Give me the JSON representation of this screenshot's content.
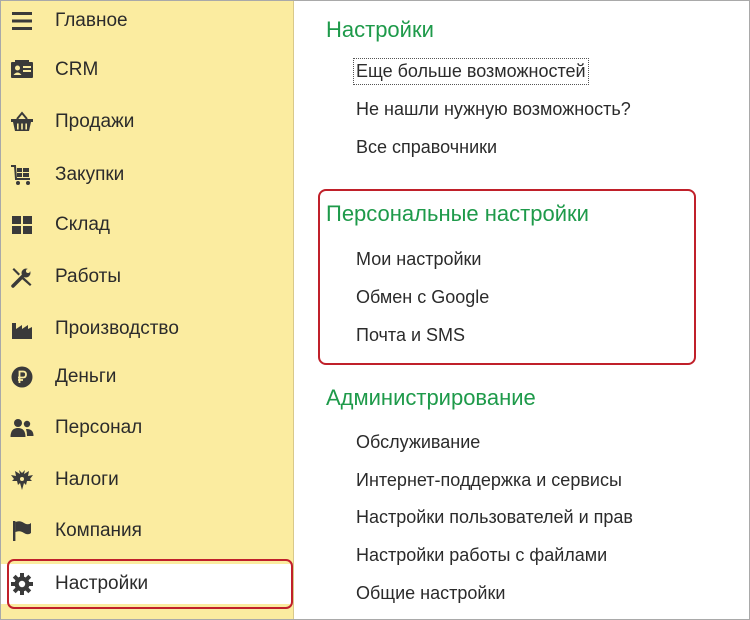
{
  "sidebar": {
    "items": [
      {
        "label": "Главное",
        "icon": "menu-lines-icon"
      },
      {
        "label": "CRM",
        "icon": "contact-card-icon"
      },
      {
        "label": "Продажи",
        "icon": "shopping-basket-icon"
      },
      {
        "label": "Закупки",
        "icon": "shopping-cart-icon"
      },
      {
        "label": "Склад",
        "icon": "warehouse-boxes-icon"
      },
      {
        "label": "Работы",
        "icon": "tools-icon"
      },
      {
        "label": "Производство",
        "icon": "factory-icon"
      },
      {
        "label": "Деньги",
        "icon": "ruble-coin-icon"
      },
      {
        "label": "Персонал",
        "icon": "people-icon"
      },
      {
        "label": "Налоги",
        "icon": "eagle-emblem-icon"
      },
      {
        "label": "Компания",
        "icon": "flag-icon"
      },
      {
        "label": "Настройки",
        "icon": "gear-icon"
      }
    ],
    "active_index": 11
  },
  "main": {
    "sections": [
      {
        "title": "Настройки",
        "links": [
          "Еще больше возможностей",
          "Не нашли нужную возможность?",
          "Все справочники"
        ]
      },
      {
        "title": "Персональные настройки",
        "links": [
          "Мои настройки",
          "Обмен с Google",
          "Почта и SMS"
        ]
      },
      {
        "title": "Администрирование",
        "links": [
          "Обслуживание",
          "Интернет-поддержка и сервисы",
          "Настройки пользователей и прав",
          "Настройки работы с файлами",
          "Общие настройки"
        ]
      }
    ]
  },
  "colors": {
    "sidebar_bg": "#fbeca0",
    "section_title": "#1e9a4a",
    "highlight_border": "#c0202a",
    "icon": "#3a3a3a"
  }
}
